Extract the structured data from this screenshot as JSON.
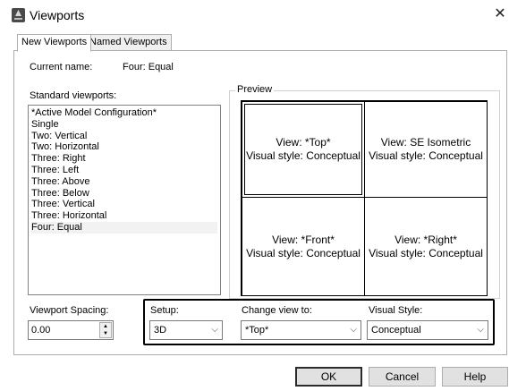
{
  "window": {
    "title": "Viewports",
    "app_icon": "autocad-app-icon",
    "close_glyph": "✕"
  },
  "tabs": [
    {
      "label": "New Viewports",
      "active": true
    },
    {
      "label": "Named Viewports",
      "active": false
    }
  ],
  "current_name": {
    "label": "Current name:",
    "value": "Four: Equal"
  },
  "standard_viewports": {
    "label": "Standard viewports:",
    "items": [
      "*Active Model Configuration*",
      "Single",
      "Two:  Vertical",
      "Two:  Horizontal",
      "Three: Right",
      "Three: Left",
      "Three: Above",
      "Three: Below",
      "Three: Vertical",
      "Three: Horizontal",
      "Four:  Equal"
    ],
    "selected": "Four:  Equal"
  },
  "preview": {
    "label": "Preview",
    "viewports": [
      {
        "view": "View: *Top*",
        "style": "Visual style: Conceptual",
        "active": true
      },
      {
        "view": "View: SE Isometric",
        "style": "Visual style: Conceptual",
        "active": false
      },
      {
        "view": "View: *Front*",
        "style": "Visual style: Conceptual",
        "active": false
      },
      {
        "view": "View: *Right*",
        "style": "Visual style: Conceptual",
        "active": false
      }
    ]
  },
  "viewport_spacing": {
    "label": "Viewport Spacing:",
    "value": "0.00"
  },
  "setup": {
    "label": "Setup:",
    "value": "3D"
  },
  "change_view": {
    "label": "Change view to:",
    "value": "*Top*"
  },
  "visual_style": {
    "label": "Visual Style:",
    "value": "Conceptual"
  },
  "buttons": {
    "ok": "OK",
    "cancel": "Cancel",
    "help": "Help"
  },
  "icons": {
    "dropdown": "chevron-down-icon",
    "spin_up": "▲",
    "spin_down": "▼",
    "chevron": "⌵"
  }
}
